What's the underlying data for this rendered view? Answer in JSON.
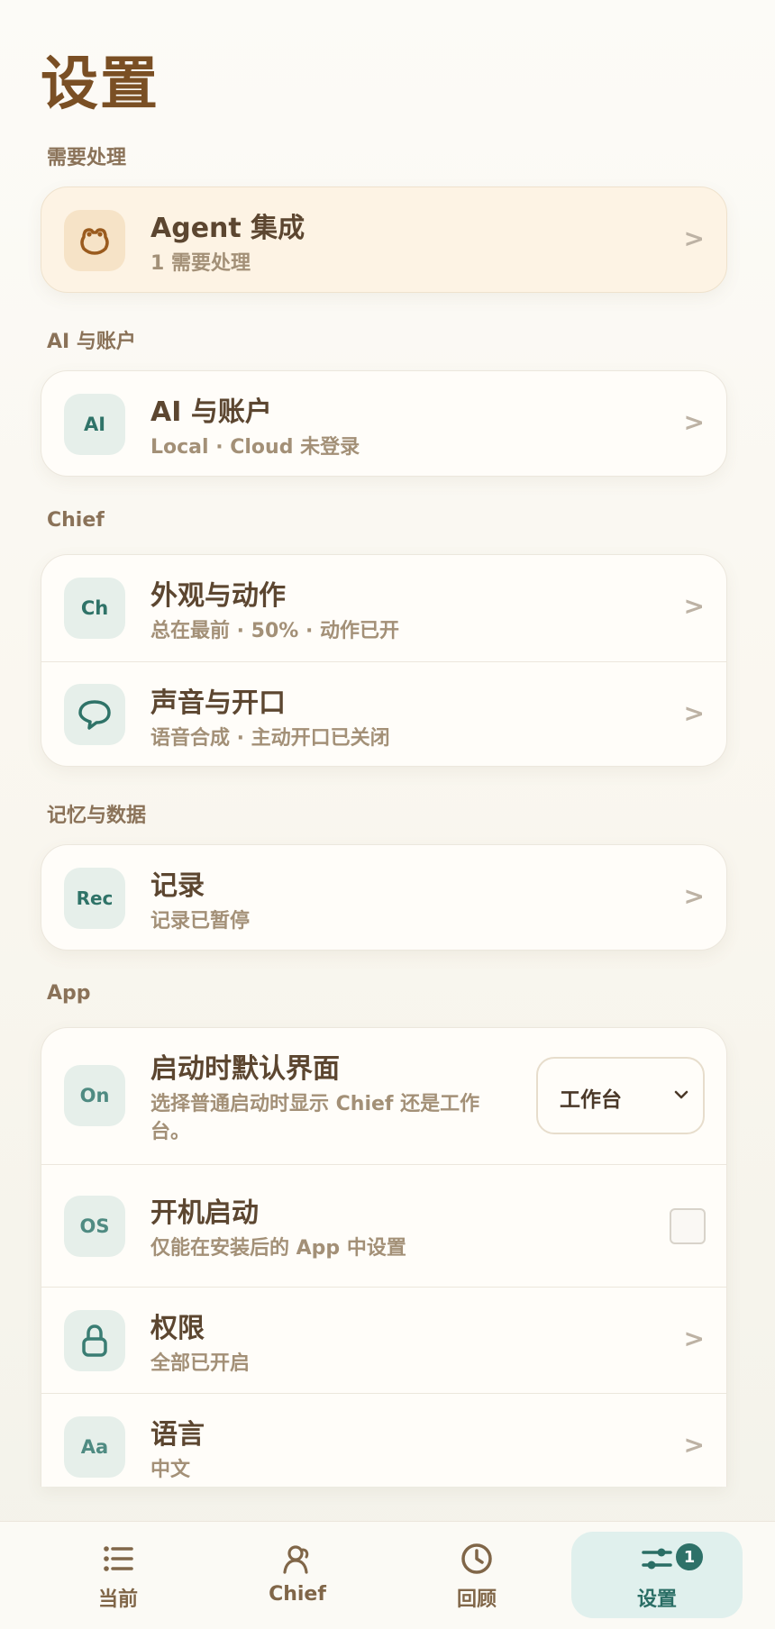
{
  "page": {
    "title": "设置"
  },
  "sections": {
    "needs_attention": {
      "label": "需要处理",
      "agent": {
        "icon_name": "agent-icon",
        "title": "Agent 集成",
        "subtitle": "1 需要处理",
        "chevron": ">"
      }
    },
    "ai_account": {
      "label": "AI 与账户",
      "item": {
        "icon_text": "AI",
        "title": "AI 与账户",
        "subtitle": "Local · Cloud 未登录",
        "chevron": ">"
      }
    },
    "chief": {
      "label": "Chief",
      "appearance": {
        "icon_text": "Ch",
        "title": "外观与动作",
        "subtitle": "总在最前 · 50% · 动作已开",
        "chevron": ">"
      },
      "voice": {
        "icon_name": "speech-bubble-icon",
        "title": "声音与开口",
        "subtitle": "语音合成 · 主动开口已关闭",
        "chevron": ">"
      }
    },
    "memory": {
      "label": "记忆与数据",
      "records": {
        "icon_text": "Rec",
        "title": "记录",
        "subtitle": "记录已暂停",
        "chevron": ">"
      }
    },
    "app": {
      "label": "App",
      "startup_view": {
        "icon_text": "On",
        "title": "启动时默认界面",
        "subtitle_line1": "选择普通启动时显示 Chief 还是工作",
        "subtitle_line2": "台。",
        "select_value": "工作台"
      },
      "launch_at_login": {
        "icon_text": "OS",
        "title": "开机启动",
        "subtitle": "仅能在安装后的 App 中设置",
        "checked": false
      },
      "permissions": {
        "icon_name": "lock-icon",
        "title": "权限",
        "subtitle": "全部已开启",
        "chevron": ">"
      },
      "language": {
        "icon_text": "Aa",
        "title": "语言",
        "subtitle": "中文",
        "chevron": ">"
      }
    }
  },
  "bottom_nav": {
    "current": {
      "label": "当前",
      "icon": "list-icon"
    },
    "chief": {
      "label": "Chief",
      "icon": "person-icon"
    },
    "review": {
      "label": "回顾",
      "icon": "clock-icon"
    },
    "settings": {
      "label": "设置",
      "icon": "sliders-icon",
      "badge": "1",
      "active": true
    }
  },
  "colors": {
    "accent": "#2e7168",
    "title_brown": "#7a4f24",
    "highlight_bg": "#fdf3e4"
  }
}
